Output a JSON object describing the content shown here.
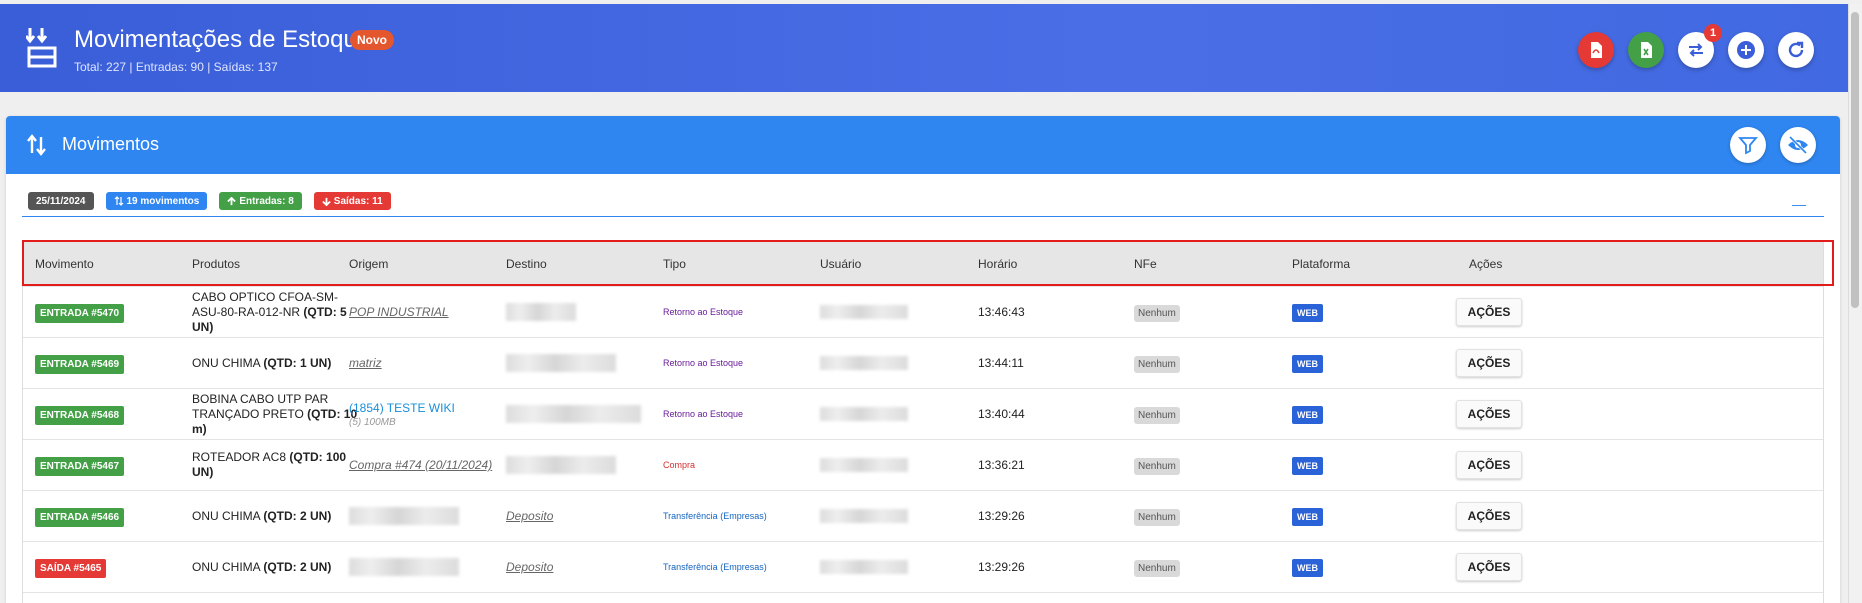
{
  "header": {
    "title": "Movimentações de Estoque",
    "new_badge": "Novo",
    "subtitle": "Total: 227 | Entradas: 90 | Saídas: 137",
    "notification_count": "1",
    "buttons": [
      {
        "name": "pdf-export-button",
        "icon": "pdf-icon",
        "color": "#e53935"
      },
      {
        "name": "excel-export-button",
        "icon": "excel-icon",
        "color": "#43a047"
      },
      {
        "name": "transfer-button",
        "icon": "transfer-icon",
        "color": "#ffffff"
      },
      {
        "name": "add-button",
        "icon": "plus-circle-icon",
        "color": "#ffffff"
      },
      {
        "name": "refresh-button",
        "icon": "refresh-icon",
        "color": "#ffffff"
      }
    ]
  },
  "panel": {
    "title": "Movimentos",
    "collapse_label": "—",
    "tags": {
      "date": "25/11/2024",
      "movements": "19 movimentos",
      "entradas": "Entradas: 8",
      "saidas": "Saídas: 11"
    }
  },
  "table": {
    "columns": [
      "Movimento",
      "Produtos",
      "Origem",
      "Destino",
      "Tipo",
      "Usuário",
      "Horário",
      "NFe",
      "Plataforma",
      "Ações"
    ],
    "rows": [
      {
        "movimento": "ENTRADA #5470",
        "mov_color": "#43a047",
        "produto_name": "CABO OPTICO CFOA-SM-ASU-80-RA-012-NR ",
        "produto_qty": "(QTD: 5 UN)",
        "origem": "POP INDUSTRIAL",
        "origem_style": "link",
        "origem_sub": "",
        "destino": "",
        "destino_style": "blur",
        "tipo": "Retorno ao Estoque",
        "tipo_color": "#6a1b9a",
        "horario": "13:46:43",
        "nfe": "Nenhum",
        "plataforma": "WEB",
        "acoes": "AÇÕES"
      },
      {
        "movimento": "ENTRADA #5469",
        "mov_color": "#43a047",
        "produto_name": "ONU CHIMA ",
        "produto_qty": "(QTD: 1 UN)",
        "origem": "matriz",
        "origem_style": "link",
        "origem_sub": "",
        "destino": "",
        "destino_style": "blur",
        "tipo": "Retorno ao Estoque",
        "tipo_color": "#6a1b9a",
        "horario": "13:44:11",
        "nfe": "Nenhum",
        "plataforma": "WEB",
        "acoes": "AÇÕES"
      },
      {
        "movimento": "ENTRADA #5468",
        "mov_color": "#43a047",
        "produto_name": "BOBINA CABO UTP PAR TRANÇADO PRETO ",
        "produto_qty": "(QTD: 10 m)",
        "origem": "(1854) TESTE WIKI",
        "origem_style": "blue",
        "origem_sub": "(5) 100MB",
        "destino": "",
        "destino_style": "blur",
        "tipo": "Retorno ao Estoque",
        "tipo_color": "#6a1b9a",
        "horario": "13:40:44",
        "nfe": "Nenhum",
        "plataforma": "WEB",
        "acoes": "AÇÕES"
      },
      {
        "movimento": "ENTRADA #5467",
        "mov_color": "#43a047",
        "produto_name": "ROTEADOR AC8 ",
        "produto_qty": "(QTD: 100 UN)",
        "origem": "Compra #474 (20/11/2024)",
        "origem_style": "link",
        "origem_sub": "",
        "destino": "",
        "destino_style": "blur",
        "tipo": "Compra",
        "tipo_color": "#d32f2f",
        "horario": "13:36:21",
        "nfe": "Nenhum",
        "plataforma": "WEB",
        "acoes": "AÇÕES"
      },
      {
        "movimento": "ENTRADA #5466",
        "mov_color": "#43a047",
        "produto_name": "ONU CHIMA ",
        "produto_qty": "(QTD: 2 UN)",
        "origem": "",
        "origem_style": "blur",
        "origem_sub": "",
        "destino": "Deposito",
        "destino_style": "link",
        "tipo": "Transferência (Empresas)",
        "tipo_color": "#1565c0",
        "horario": "13:29:26",
        "nfe": "Nenhum",
        "plataforma": "WEB",
        "acoes": "AÇÕES"
      },
      {
        "movimento": "SAÍDA #5465",
        "mov_color": "#e53935",
        "produto_name": "ONU CHIMA ",
        "produto_qty": "(QTD: 2 UN)",
        "origem": "",
        "origem_style": "blur",
        "origem_sub": "",
        "destino": "Deposito",
        "destino_style": "link",
        "tipo": "Transferência (Empresas)",
        "tipo_color": "#1565c0",
        "horario": "13:29:26",
        "nfe": "Nenhum",
        "plataforma": "WEB",
        "acoes": "AÇÕES"
      }
    ]
  }
}
